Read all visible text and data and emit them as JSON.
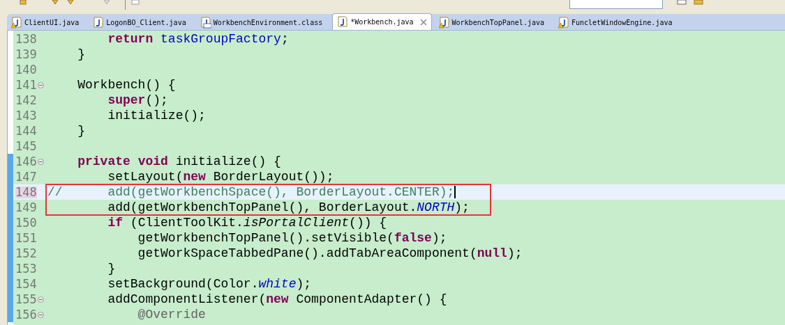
{
  "tabs": [
    {
      "label": "ClientUI.java",
      "kind": "java",
      "warning": true,
      "selected": false
    },
    {
      "label": "LogonBO_Client.java",
      "kind": "java",
      "warning": false,
      "selected": false
    },
    {
      "label": "WorkbenchEnvironment.class",
      "kind": "class",
      "warning": false,
      "selected": false
    },
    {
      "label": "*Workbench.java",
      "kind": "java",
      "warning": false,
      "selected": true
    },
    {
      "label": "WorkbenchTopPanel.java",
      "kind": "java",
      "warning": true,
      "selected": false
    },
    {
      "label": "FuncletWindowEngine.java",
      "kind": "java",
      "warning": true,
      "selected": false
    }
  ],
  "editor": {
    "lines": [
      {
        "number": "138",
        "fold": false,
        "changed": false,
        "current": false,
        "boxed": false,
        "cursor": false,
        "tokens": [
          {
            "kind": "keyword",
            "text": "        return"
          },
          {
            "kind": "field",
            "text": " taskGroupFactory"
          },
          {
            "kind": "plain",
            "text": ";"
          }
        ]
      },
      {
        "number": "139",
        "fold": false,
        "changed": false,
        "current": false,
        "boxed": false,
        "cursor": false,
        "tokens": [
          {
            "kind": "plain",
            "text": "    }"
          }
        ]
      },
      {
        "number": "140",
        "fold": false,
        "changed": false,
        "current": false,
        "boxed": false,
        "cursor": false
      },
      {
        "number": "141",
        "fold": true,
        "changed": false,
        "current": false,
        "boxed": false,
        "cursor": false,
        "tokens": [
          {
            "kind": "plain",
            "text": "    Workbench() {"
          }
        ]
      },
      {
        "number": "142",
        "fold": false,
        "changed": false,
        "current": false,
        "boxed": false,
        "cursor": false,
        "tokens": [
          {
            "kind": "keyword",
            "text": "        super"
          },
          {
            "kind": "plain",
            "text": "();"
          }
        ]
      },
      {
        "number": "143",
        "fold": false,
        "changed": false,
        "current": false,
        "boxed": false,
        "cursor": false,
        "tokens": [
          {
            "kind": "plain",
            "text": "        initialize();"
          }
        ]
      },
      {
        "number": "144",
        "fold": false,
        "changed": false,
        "current": false,
        "boxed": false,
        "cursor": false,
        "tokens": [
          {
            "kind": "plain",
            "text": "    }"
          }
        ]
      },
      {
        "number": "145",
        "fold": false,
        "changed": false,
        "current": false,
        "boxed": false,
        "cursor": false
      },
      {
        "number": "146",
        "fold": true,
        "changed": true,
        "current": false,
        "boxed": false,
        "cursor": false,
        "tokens": [
          {
            "kind": "keyword",
            "text": "    private"
          },
          {
            "kind": "keyword",
            "text": " void"
          },
          {
            "kind": "plain",
            "text": " initialize() {"
          }
        ]
      },
      {
        "number": "147",
        "fold": false,
        "changed": true,
        "current": false,
        "boxed": false,
        "cursor": false,
        "tokens": [
          {
            "kind": "plain",
            "text": "        setLayout("
          },
          {
            "kind": "keyword",
            "text": "new"
          },
          {
            "kind": "plain",
            "text": " BorderLayout());"
          }
        ]
      },
      {
        "number": "148",
        "fold": false,
        "changed": true,
        "current": true,
        "boxed": true,
        "cursor": true,
        "tokens": [
          {
            "kind": "comment",
            "text": "//      add(getWorkbenchSpace(), BorderLayout.CENTER);"
          }
        ]
      },
      {
        "number": "149",
        "fold": false,
        "changed": true,
        "current": false,
        "boxed": true,
        "cursor": false,
        "tokens": [
          {
            "kind": "plain",
            "text": "        add(getWorkbenchTopPanel(), BorderLayout."
          },
          {
            "kind": "static",
            "text": "NORTH"
          },
          {
            "kind": "plain",
            "text": ");"
          }
        ]
      },
      {
        "number": "150",
        "fold": false,
        "changed": true,
        "current": false,
        "boxed": false,
        "cursor": false,
        "tokens": [
          {
            "kind": "keyword",
            "text": "        if"
          },
          {
            "kind": "plain",
            "text": " (ClientToolKit."
          },
          {
            "kind": "method",
            "text": "isPortalClient"
          },
          {
            "kind": "plain",
            "text": "()) {"
          }
        ]
      },
      {
        "number": "151",
        "fold": false,
        "changed": true,
        "current": false,
        "boxed": false,
        "cursor": false,
        "tokens": [
          {
            "kind": "plain",
            "text": "            getWorkbenchTopPanel().setVisible("
          },
          {
            "kind": "keyword",
            "text": "false"
          },
          {
            "kind": "plain",
            "text": ");"
          }
        ]
      },
      {
        "number": "152",
        "fold": false,
        "changed": true,
        "current": false,
        "boxed": false,
        "cursor": false,
        "tokens": [
          {
            "kind": "plain",
            "text": "            getWorkSpaceTabbedPane().addTabAreaComponent("
          },
          {
            "kind": "keyword",
            "text": "null"
          },
          {
            "kind": "plain",
            "text": ");"
          }
        ]
      },
      {
        "number": "153",
        "fold": false,
        "changed": true,
        "current": false,
        "boxed": false,
        "cursor": false,
        "tokens": [
          {
            "kind": "plain",
            "text": "        }"
          }
        ]
      },
      {
        "number": "154",
        "fold": false,
        "changed": true,
        "current": false,
        "boxed": false,
        "cursor": false,
        "tokens": [
          {
            "kind": "plain",
            "text": "        setBackground(Color."
          },
          {
            "kind": "static",
            "text": "white"
          },
          {
            "kind": "plain",
            "text": ");"
          }
        ]
      },
      {
        "number": "155",
        "fold": true,
        "changed": true,
        "current": false,
        "boxed": false,
        "cursor": false,
        "tokens": [
          {
            "kind": "plain",
            "text": "        addComponentListener("
          },
          {
            "kind": "keyword",
            "text": "new"
          },
          {
            "kind": "plain",
            "text": " ComponentAdapter() {"
          }
        ]
      },
      {
        "number": "156",
        "fold": true,
        "changed": true,
        "current": false,
        "boxed": false,
        "cursor": false,
        "tokens": [
          {
            "kind": "annotation",
            "text": "            @Override"
          }
        ]
      }
    ]
  }
}
